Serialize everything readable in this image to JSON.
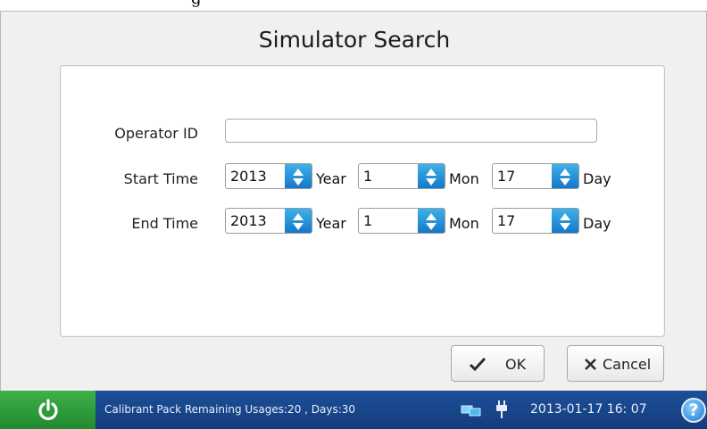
{
  "window": {
    "title": "Simulator Search"
  },
  "form": {
    "operator_label": "Operator ID",
    "operator_value": "",
    "start_label": "Start Time",
    "end_label": "End Time",
    "start": {
      "year": "2013",
      "month": "1",
      "day": "17"
    },
    "end": {
      "year": "2013",
      "month": "1",
      "day": "17"
    },
    "units": {
      "year": "Year",
      "month": "Mon",
      "day": "Day"
    }
  },
  "actions": {
    "ok_label": "OK",
    "cancel_label": "Cancel"
  },
  "status": {
    "message": "Calibrant Pack Remaining Usages:20 , Days:30",
    "datetime": "2013-01-17 16: 07",
    "help_symbol": "?"
  },
  "icons": [
    "power-icon",
    "network-icon",
    "plug-icon",
    "help-icon",
    "check-icon",
    "x-icon",
    "spin-arrows-icon"
  ],
  "colors": {
    "status_bar": "#1a4a92",
    "power_button": "#2e9d3b",
    "spin_button": "#2a93dc"
  }
}
